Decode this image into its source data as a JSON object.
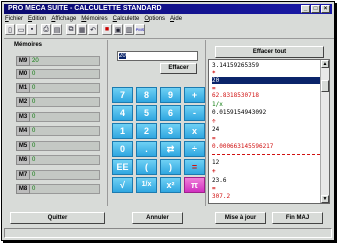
{
  "window": {
    "title": "PRO MECA SUITE - CALCULETTE STANDARD"
  },
  "menu": [
    "Fichier",
    "Edition",
    "Affichage",
    "Mémoires",
    "Calculette",
    "Options",
    "Aide"
  ],
  "toolbar_icons": [
    "doc-icon",
    "open-icon",
    "save-icon",
    "print-icon",
    "preview-icon",
    "copy-icon",
    "paste-icon",
    "undo-icon",
    "stop-icon",
    "calc-icon",
    "grid-icon",
    "pms-icon"
  ],
  "memories": {
    "title": "Mémoires",
    "items": [
      {
        "label": "M9",
        "value": "20"
      },
      {
        "label": "M0",
        "value": "0"
      },
      {
        "label": "M1",
        "value": "0"
      },
      {
        "label": "M2",
        "value": "0"
      },
      {
        "label": "M3",
        "value": "0"
      },
      {
        "label": "M4",
        "value": "0"
      },
      {
        "label": "M5",
        "value": "0"
      },
      {
        "label": "M6",
        "value": "0"
      },
      {
        "label": "M7",
        "value": "0"
      },
      {
        "label": "M8",
        "value": "0"
      }
    ]
  },
  "calculator": {
    "input_value": "20",
    "effacer_label": "Effacer",
    "keys": [
      [
        "7",
        "8",
        "9",
        "+"
      ],
      [
        "4",
        "5",
        "6",
        "-"
      ],
      [
        "1",
        "2",
        "3",
        "x"
      ],
      [
        "0",
        ".",
        "⇄",
        "÷"
      ],
      [
        "EE",
        "(",
        ")",
        "="
      ],
      [
        "√",
        "1/x",
        "x²",
        "π"
      ]
    ]
  },
  "history": {
    "clear_all_label": "Effacer tout",
    "lines": [
      {
        "text": "3.14159265359",
        "style": ""
      },
      {
        "text": "*",
        "style": "op"
      },
      {
        "text": "20",
        "style": "sel"
      },
      {
        "text": "=",
        "style": "op"
      },
      {
        "text": "62.8318530718",
        "style": "red"
      },
      {
        "text": "1/x",
        "style": "green"
      },
      {
        "text": "0.0159154943092",
        "style": ""
      },
      {
        "text": "÷",
        "style": "op"
      },
      {
        "text": "24",
        "style": ""
      },
      {
        "text": "=",
        "style": "op"
      },
      {
        "text": "0.000663145596217",
        "style": "red"
      },
      {
        "text": "12",
        "style": ""
      },
      {
        "text": "+",
        "style": "op"
      },
      {
        "text": "23.6",
        "style": ""
      },
      {
        "text": "=",
        "style": "op"
      },
      {
        "text": "307.2",
        "style": "red"
      }
    ]
  },
  "buttons": {
    "quitter": "Quitter",
    "annuler": "Annuler",
    "mise_a_jour": "Mise à jour",
    "fin_maj": "Fin MAJ"
  }
}
